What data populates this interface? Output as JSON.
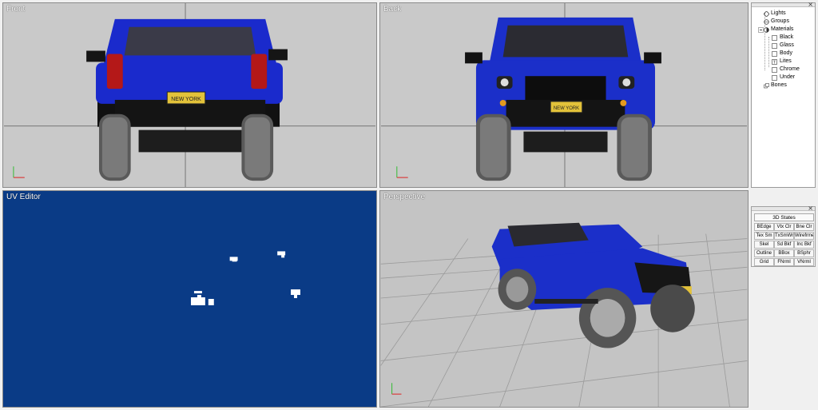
{
  "viewports": {
    "front": {
      "label": "Front"
    },
    "back": {
      "label": "Back"
    },
    "uv": {
      "label": "UV Editor"
    },
    "perspective": {
      "label": "Perspective"
    }
  },
  "plate_text": "NEW YORK",
  "tree": {
    "items": [
      {
        "label": "Lights",
        "icon": "light-icon"
      },
      {
        "label": "Groups",
        "icon": "group-icon"
      },
      {
        "label": "Materials",
        "icon": "material-icon"
      },
      {
        "label": "Black",
        "icon": "texture-icon"
      },
      {
        "label": "Glass",
        "icon": "texture-icon"
      },
      {
        "label": "Body",
        "icon": "texture-icon"
      },
      {
        "label": "Lites",
        "icon": "texture-icon"
      },
      {
        "label": "Chrome",
        "icon": "texture-icon"
      },
      {
        "label": "Under",
        "icon": "texture-icon"
      },
      {
        "label": "Bones",
        "icon": "bones-icon"
      }
    ]
  },
  "states": {
    "header": "3D States",
    "buttons": [
      [
        "BEdge",
        "Vtx Clr",
        "Bne Clr"
      ],
      [
        "Tex Sm",
        "TxSmWr",
        "Wirefrme"
      ],
      [
        "Skel",
        "Sd Bkf",
        "Inc Bkf"
      ],
      [
        "Outline",
        "BBox",
        "BSphr"
      ],
      [
        "Grid",
        "FNrml",
        "VNrml"
      ]
    ]
  },
  "colors": {
    "body_blue": "#1b2fc9",
    "uv_background": "#0a3b86",
    "viewport_gray": "#c9c9c9"
  }
}
